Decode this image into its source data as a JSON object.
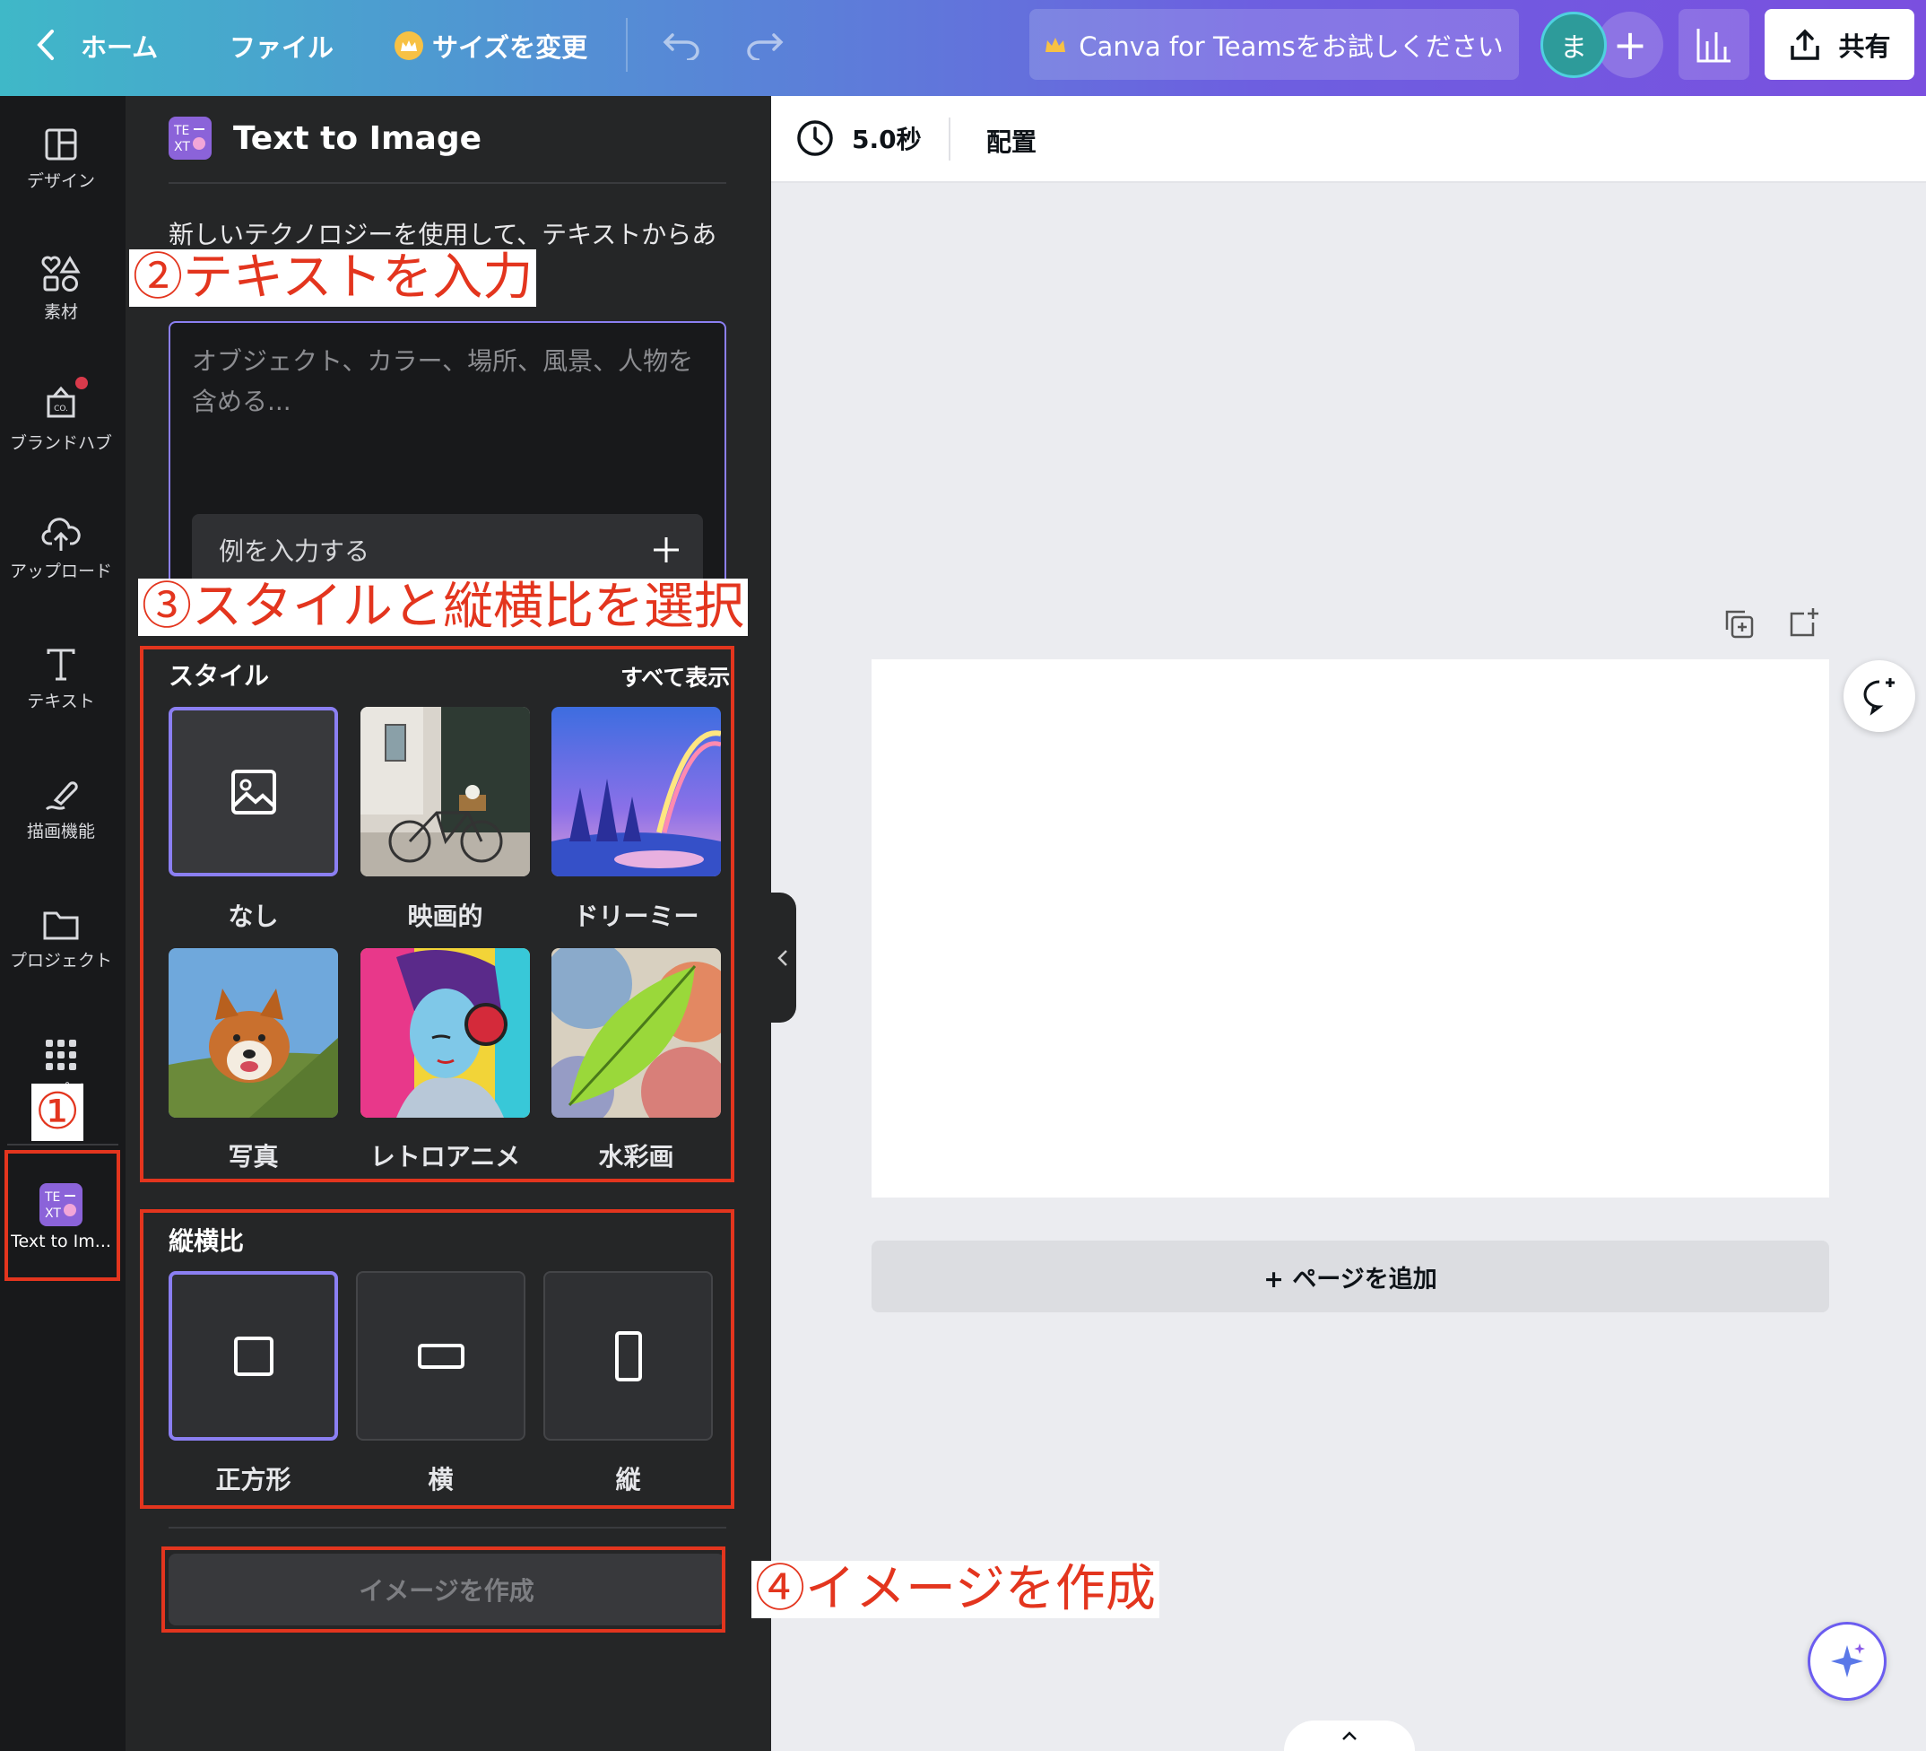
{
  "topbar": {
    "home_label": "ホーム",
    "file_label": "ファイル",
    "resize_label": "サイズを変更",
    "teams_label": "Canva for Teamsをお試しください",
    "avatar_initial": "ま",
    "share_label": "共有"
  },
  "sidebar": {
    "items": [
      {
        "label": "デザイン",
        "icon": "layout-icon"
      },
      {
        "label": "素材",
        "icon": "shapes-icon"
      },
      {
        "label": "ブランドハブ",
        "icon": "brand-hub-icon"
      },
      {
        "label": "アップロード",
        "icon": "cloud-upload-icon"
      },
      {
        "label": "テキスト",
        "icon": "text-icon"
      },
      {
        "label": "描画機能",
        "icon": "draw-icon"
      },
      {
        "label": "プロジェクト",
        "icon": "folder-icon"
      },
      {
        "label": "アプリ",
        "icon": "apps-grid-icon"
      },
      {
        "label": "Text to Im...",
        "icon": "text-to-image-icon"
      }
    ]
  },
  "panel": {
    "title": "Text to Image",
    "description": "新しいテクノロジーを使用して、テキストからあ",
    "prompt_placeholder": "オブジェクト、カラー、場所、風景、人物を含める...",
    "example_button": "例を入力する",
    "style_title": "スタイル",
    "see_all": "すべて表示",
    "styles": [
      {
        "label": "なし",
        "selected": true
      },
      {
        "label": "映画的",
        "selected": false
      },
      {
        "label": "ドリーミー",
        "selected": false
      },
      {
        "label": "写真",
        "selected": false
      },
      {
        "label": "レトロアニメ",
        "selected": false
      },
      {
        "label": "水彩画",
        "selected": false
      }
    ],
    "ratio_title": "縦横比",
    "ratios": [
      {
        "label": "正方形",
        "selected": true
      },
      {
        "label": "横",
        "selected": false
      },
      {
        "label": "縦",
        "selected": false
      }
    ],
    "create_button": "イメージを作成"
  },
  "canvas": {
    "duration": "5.0秒",
    "arrange_label": "配置",
    "add_page": "+ ページを追加"
  },
  "annotations": {
    "step1": "①",
    "step2": "②テキストを入力",
    "step3": "③スタイルと縦横比を選択",
    "step4": "④イメージを作成"
  },
  "colors": {
    "accent": "#8b7ff2",
    "annotation_red": "#e3351e",
    "panel_bg": "#252627",
    "rail_bg": "#18191b"
  }
}
